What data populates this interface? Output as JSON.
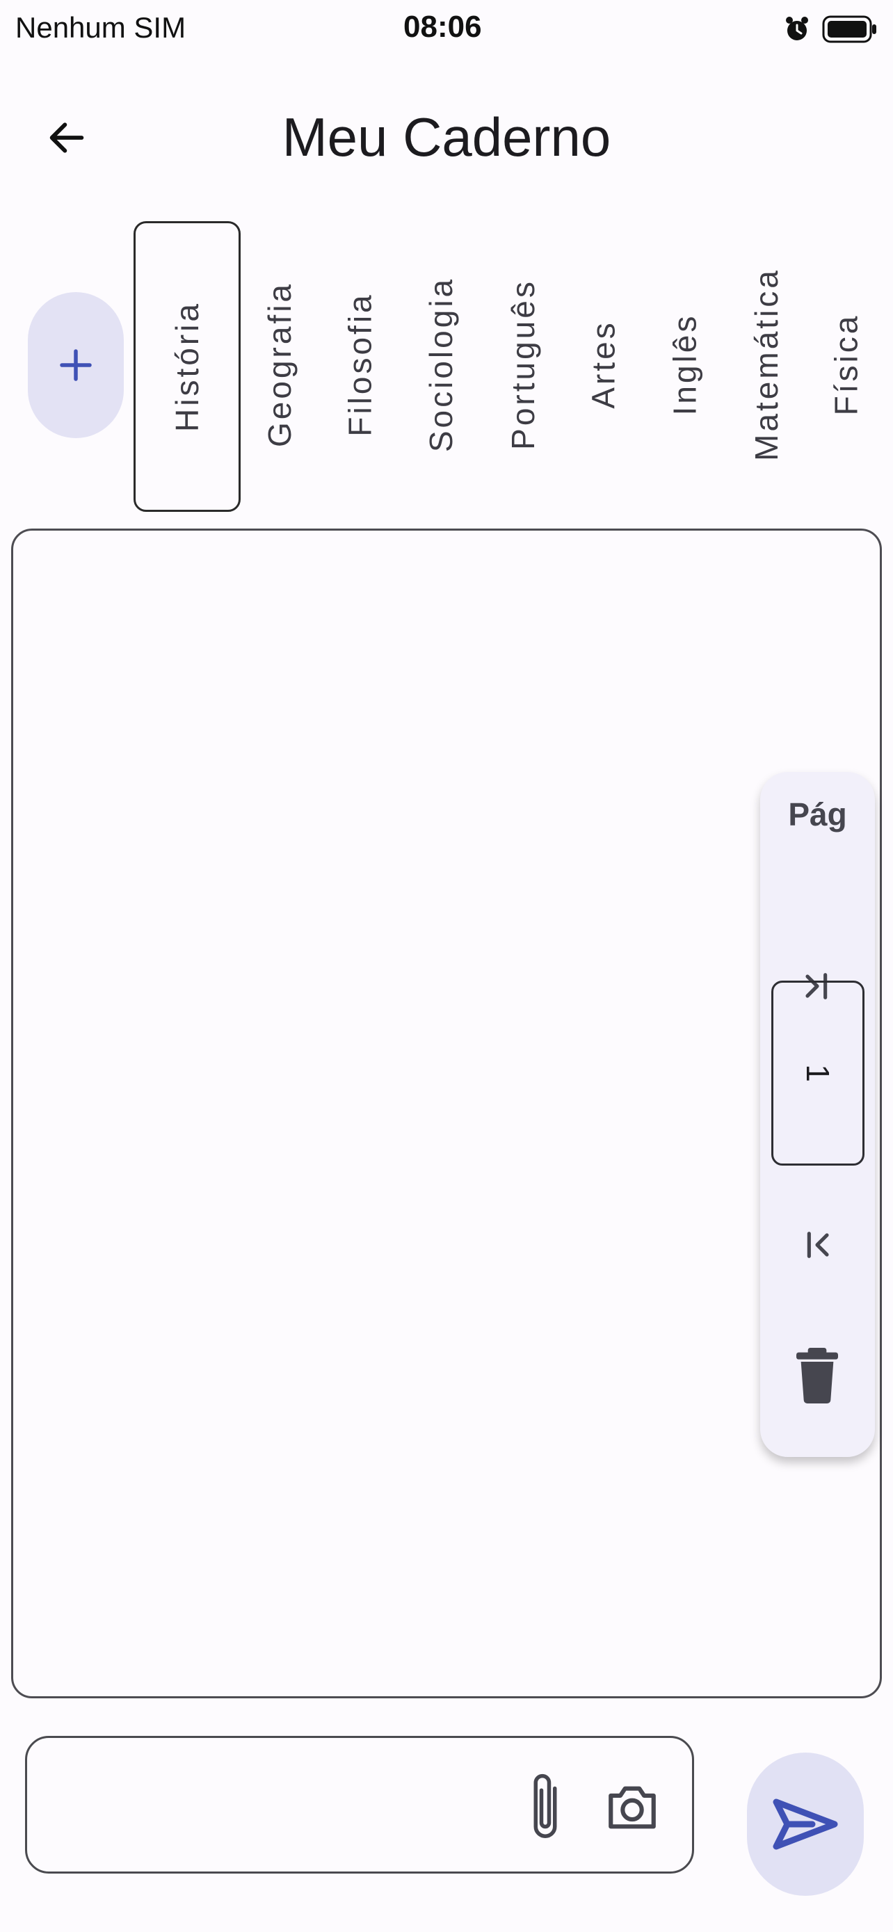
{
  "status_bar": {
    "carrier": "Nenhum SIM",
    "time": "08:06",
    "icons": [
      "alarm-icon",
      "battery-icon"
    ]
  },
  "app_bar": {
    "title": "Meu Caderno",
    "back_icon": "arrow-left-icon"
  },
  "subjects": {
    "add_icon": "plus-icon",
    "selected": "História",
    "items": [
      "História",
      "Geografia",
      "Filosofia",
      "Sociologia",
      "Português",
      "Artes",
      "Inglês",
      "Matemática",
      "Física"
    ]
  },
  "page_panel": {
    "label": "Pág",
    "current_page": "1",
    "buttons": [
      "last-page-icon",
      "first-page-icon",
      "trash-icon"
    ]
  },
  "input": {
    "value": "",
    "icons": [
      "paperclip-icon",
      "camera-icon"
    ],
    "send_icon": "send-icon"
  },
  "colors": {
    "accent": "#3f51b5",
    "accent_container": "#e3e2f4",
    "background": "#fdfbfe",
    "panel": "#f2f0fa"
  }
}
